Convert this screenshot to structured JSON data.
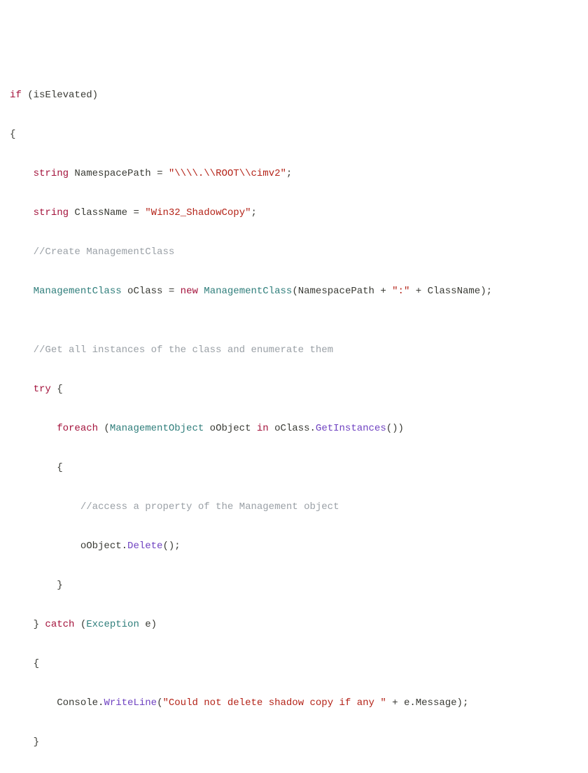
{
  "code": {
    "line1": {
      "kw1": "if",
      "rest": " (isElevated)"
    },
    "line2": "{",
    "line3": {
      "kw": "string",
      "ident": " NamespacePath ",
      "eq": "= ",
      "str": "\"\\\\\\\\.\\\\ROOT\\\\cimv2\"",
      "semi": ";"
    },
    "line4": {
      "kw": "string",
      "ident": " ClassName ",
      "eq": "= ",
      "str": "\"Win32_ShadowCopy\"",
      "semi": ";"
    },
    "line5": {
      "comment": "//Create ManagementClass"
    },
    "line6": {
      "type1": "ManagementClass",
      "sp1": " oClass ",
      "eq": "= ",
      "kw": "new",
      "sp2": " ",
      "type2": "ManagementClass",
      "open": "(NamespacePath + ",
      "str1": "\":\"",
      "mid": " + ClassName);"
    },
    "line7_blank": "",
    "line8": {
      "comment": "//Get all instances of the class and enumerate them"
    },
    "line9": {
      "kw": "try",
      "rest": " {"
    },
    "line10": {
      "kw1": "foreach",
      "sp1": " (",
      "type": "ManagementObject",
      "sp2": " oObject ",
      "kw2": "in",
      "sp3": " oClass.",
      "method": "GetInstances",
      "rest": "())"
    },
    "line11": "{",
    "line12": {
      "comment": "//access a property of the Management object"
    },
    "line13": {
      "pre": "oObject.",
      "method": "Delete",
      "rest": "();"
    },
    "line14": "}",
    "line15": {
      "close": "} ",
      "kw": "catch",
      "sp": " (",
      "type": "Exception",
      "rest": " e)"
    },
    "line16": "{",
    "line17": {
      "pre": "Console.",
      "method": "WriteLine",
      "open": "(",
      "str": "\"Could not delete shadow copy if any \"",
      "rest": " + e.Message);"
    },
    "line18": "}"
  }
}
